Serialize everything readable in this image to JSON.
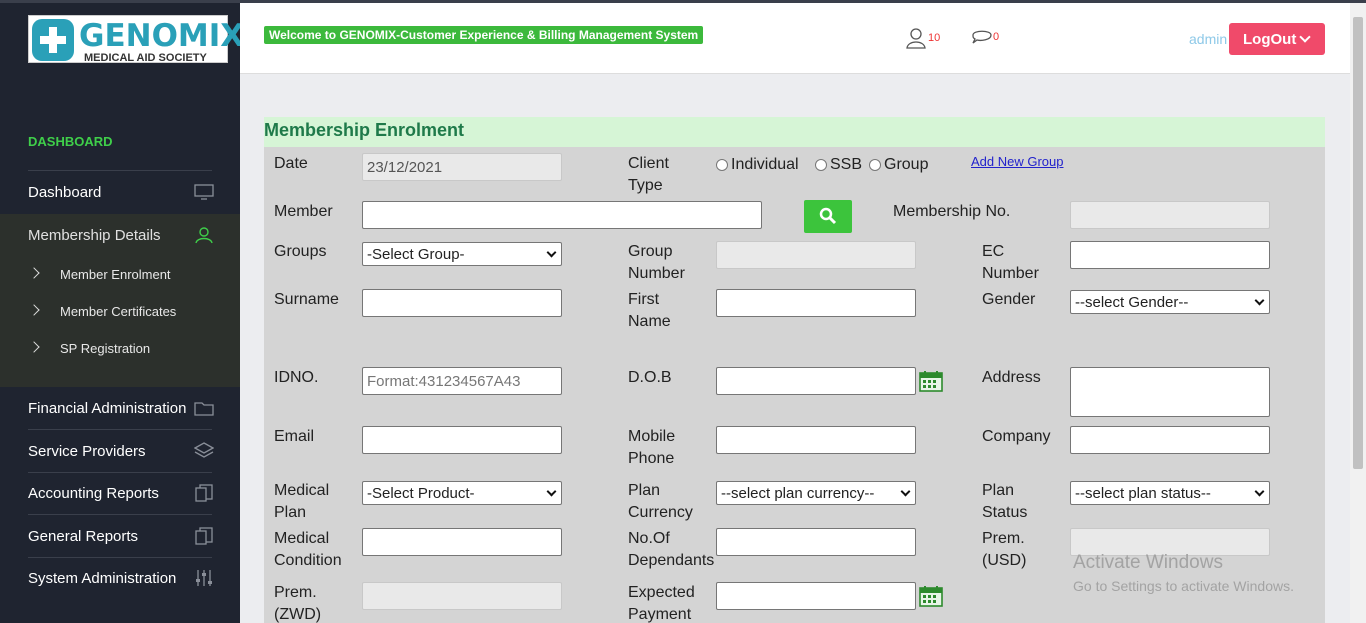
{
  "logo": {
    "brand": "GENOMIX",
    "subtitle": "MEDICAL AID SOCIETY"
  },
  "sidebar": {
    "section_title": "DASHBOARD",
    "items": [
      {
        "label": "Dashboard",
        "icon": "monitor-icon"
      },
      {
        "label": "Membership Details",
        "icon": "user-icon"
      },
      {
        "label": "Financial Administration",
        "icon": "folder-icon"
      },
      {
        "label": "Service Providers",
        "icon": "layers-icon"
      },
      {
        "label": "Accounting Reports",
        "icon": "copy-icon"
      },
      {
        "label": "General Reports",
        "icon": "copy-icon"
      },
      {
        "label": "System Administration",
        "icon": "sliders-icon"
      }
    ],
    "sub_items": [
      "Member Enrolment",
      "Member Certificates",
      "SP Registration"
    ],
    "accent_color": "#3fcf4a"
  },
  "header": {
    "welcome": "Welcome to GENOMIX-Customer Experience & Billing Management System",
    "user_count": "10",
    "message_count": "0",
    "user": "admin",
    "logout_label": "LogOut"
  },
  "form": {
    "title": "Membership Enrolment",
    "date_label": "Date",
    "date_value": "23/12/2021",
    "client_type_label": "Client Type",
    "client_types": [
      "Individual",
      "SSB",
      "Group"
    ],
    "add_group_link": "Add New Group",
    "member_label": "Member",
    "membership_no_label": "Membership No.",
    "groups_label": "Groups",
    "groups_value": "-Select Group-",
    "group_number_label": "Group Number",
    "ec_number_label": "EC Number",
    "surname_label": "Surname",
    "first_name_label": "First Name",
    "gender_label": "Gender",
    "gender_value": "--select Gender--",
    "idno_label": "IDNO.",
    "idno_placeholder": "Format:431234567A43",
    "dob_label": "D.O.B",
    "address_label": "Address",
    "email_label": "Email",
    "mobile_label": "Mobile Phone",
    "company_label": "Company",
    "medical_plan_label": "Medical Plan",
    "medical_plan_value": "-Select Product-",
    "plan_currency_label": "Plan Currency",
    "plan_currency_value": "--select plan currency--",
    "plan_status_label": "Plan Status",
    "plan_status_value": "--select plan status--",
    "medical_condition_label": "Medical Condition",
    "dependants_label": "No.Of Dependants",
    "prem_usd_label": "Prem. (USD)",
    "prem_zwd_label": "Prem. (ZWD)",
    "expected_payment_label": "Expected Payment"
  },
  "watermark": {
    "line1": "Activate Windows",
    "line2": "Go to Settings to activate Windows."
  }
}
